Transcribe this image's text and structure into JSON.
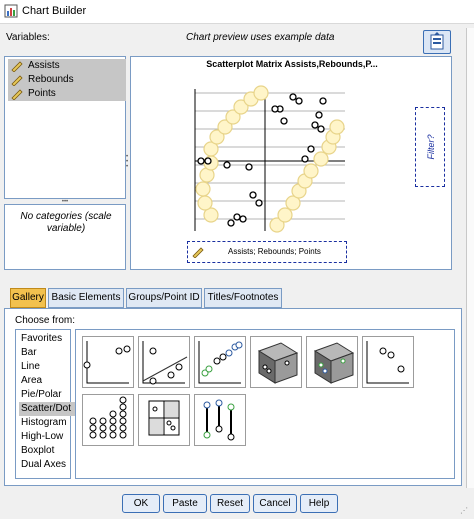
{
  "window": {
    "title": "Chart Builder"
  },
  "variables": {
    "label": "Variables:",
    "items": [
      {
        "label": "Assists"
      },
      {
        "label": "Rebounds"
      },
      {
        "label": "Points"
      }
    ],
    "no_categories": "No categories (scale variable)"
  },
  "preview": {
    "caption": "Chart preview uses example data",
    "chart_title": "Scatterplot Matrix Assists,Rebounds,P...",
    "axis_drop_label": "Assists; Rebounds; Points",
    "filter_label": "Filter?"
  },
  "tabs": [
    {
      "label": "Gallery",
      "active": true
    },
    {
      "label": "Basic Elements",
      "active": false
    },
    {
      "label": "Groups/Point ID",
      "active": false
    },
    {
      "label": "Titles/Footnotes",
      "active": false
    }
  ],
  "gallery": {
    "choose_label": "Choose from:",
    "categories": [
      {
        "label": "Favorites",
        "selected": false
      },
      {
        "label": "Bar",
        "selected": false
      },
      {
        "label": "Line",
        "selected": false
      },
      {
        "label": "Area",
        "selected": false
      },
      {
        "label": "Pie/Polar",
        "selected": false
      },
      {
        "label": "Scatter/Dot",
        "selected": true
      },
      {
        "label": "Histogram",
        "selected": false
      },
      {
        "label": "High-Low",
        "selected": false
      },
      {
        "label": "Boxplot",
        "selected": false
      },
      {
        "label": "Dual Axes",
        "selected": false
      }
    ]
  },
  "buttons": {
    "ok": "OK",
    "paste": "Paste",
    "reset": "Reset",
    "cancel": "Cancel",
    "help": "Help"
  },
  "colors": {
    "accent_tab": "#f2c14e",
    "border_blue": "#7a9bc4",
    "ruler_yellow": "#e6c85a",
    "circle_fill": "#fff5c9"
  }
}
